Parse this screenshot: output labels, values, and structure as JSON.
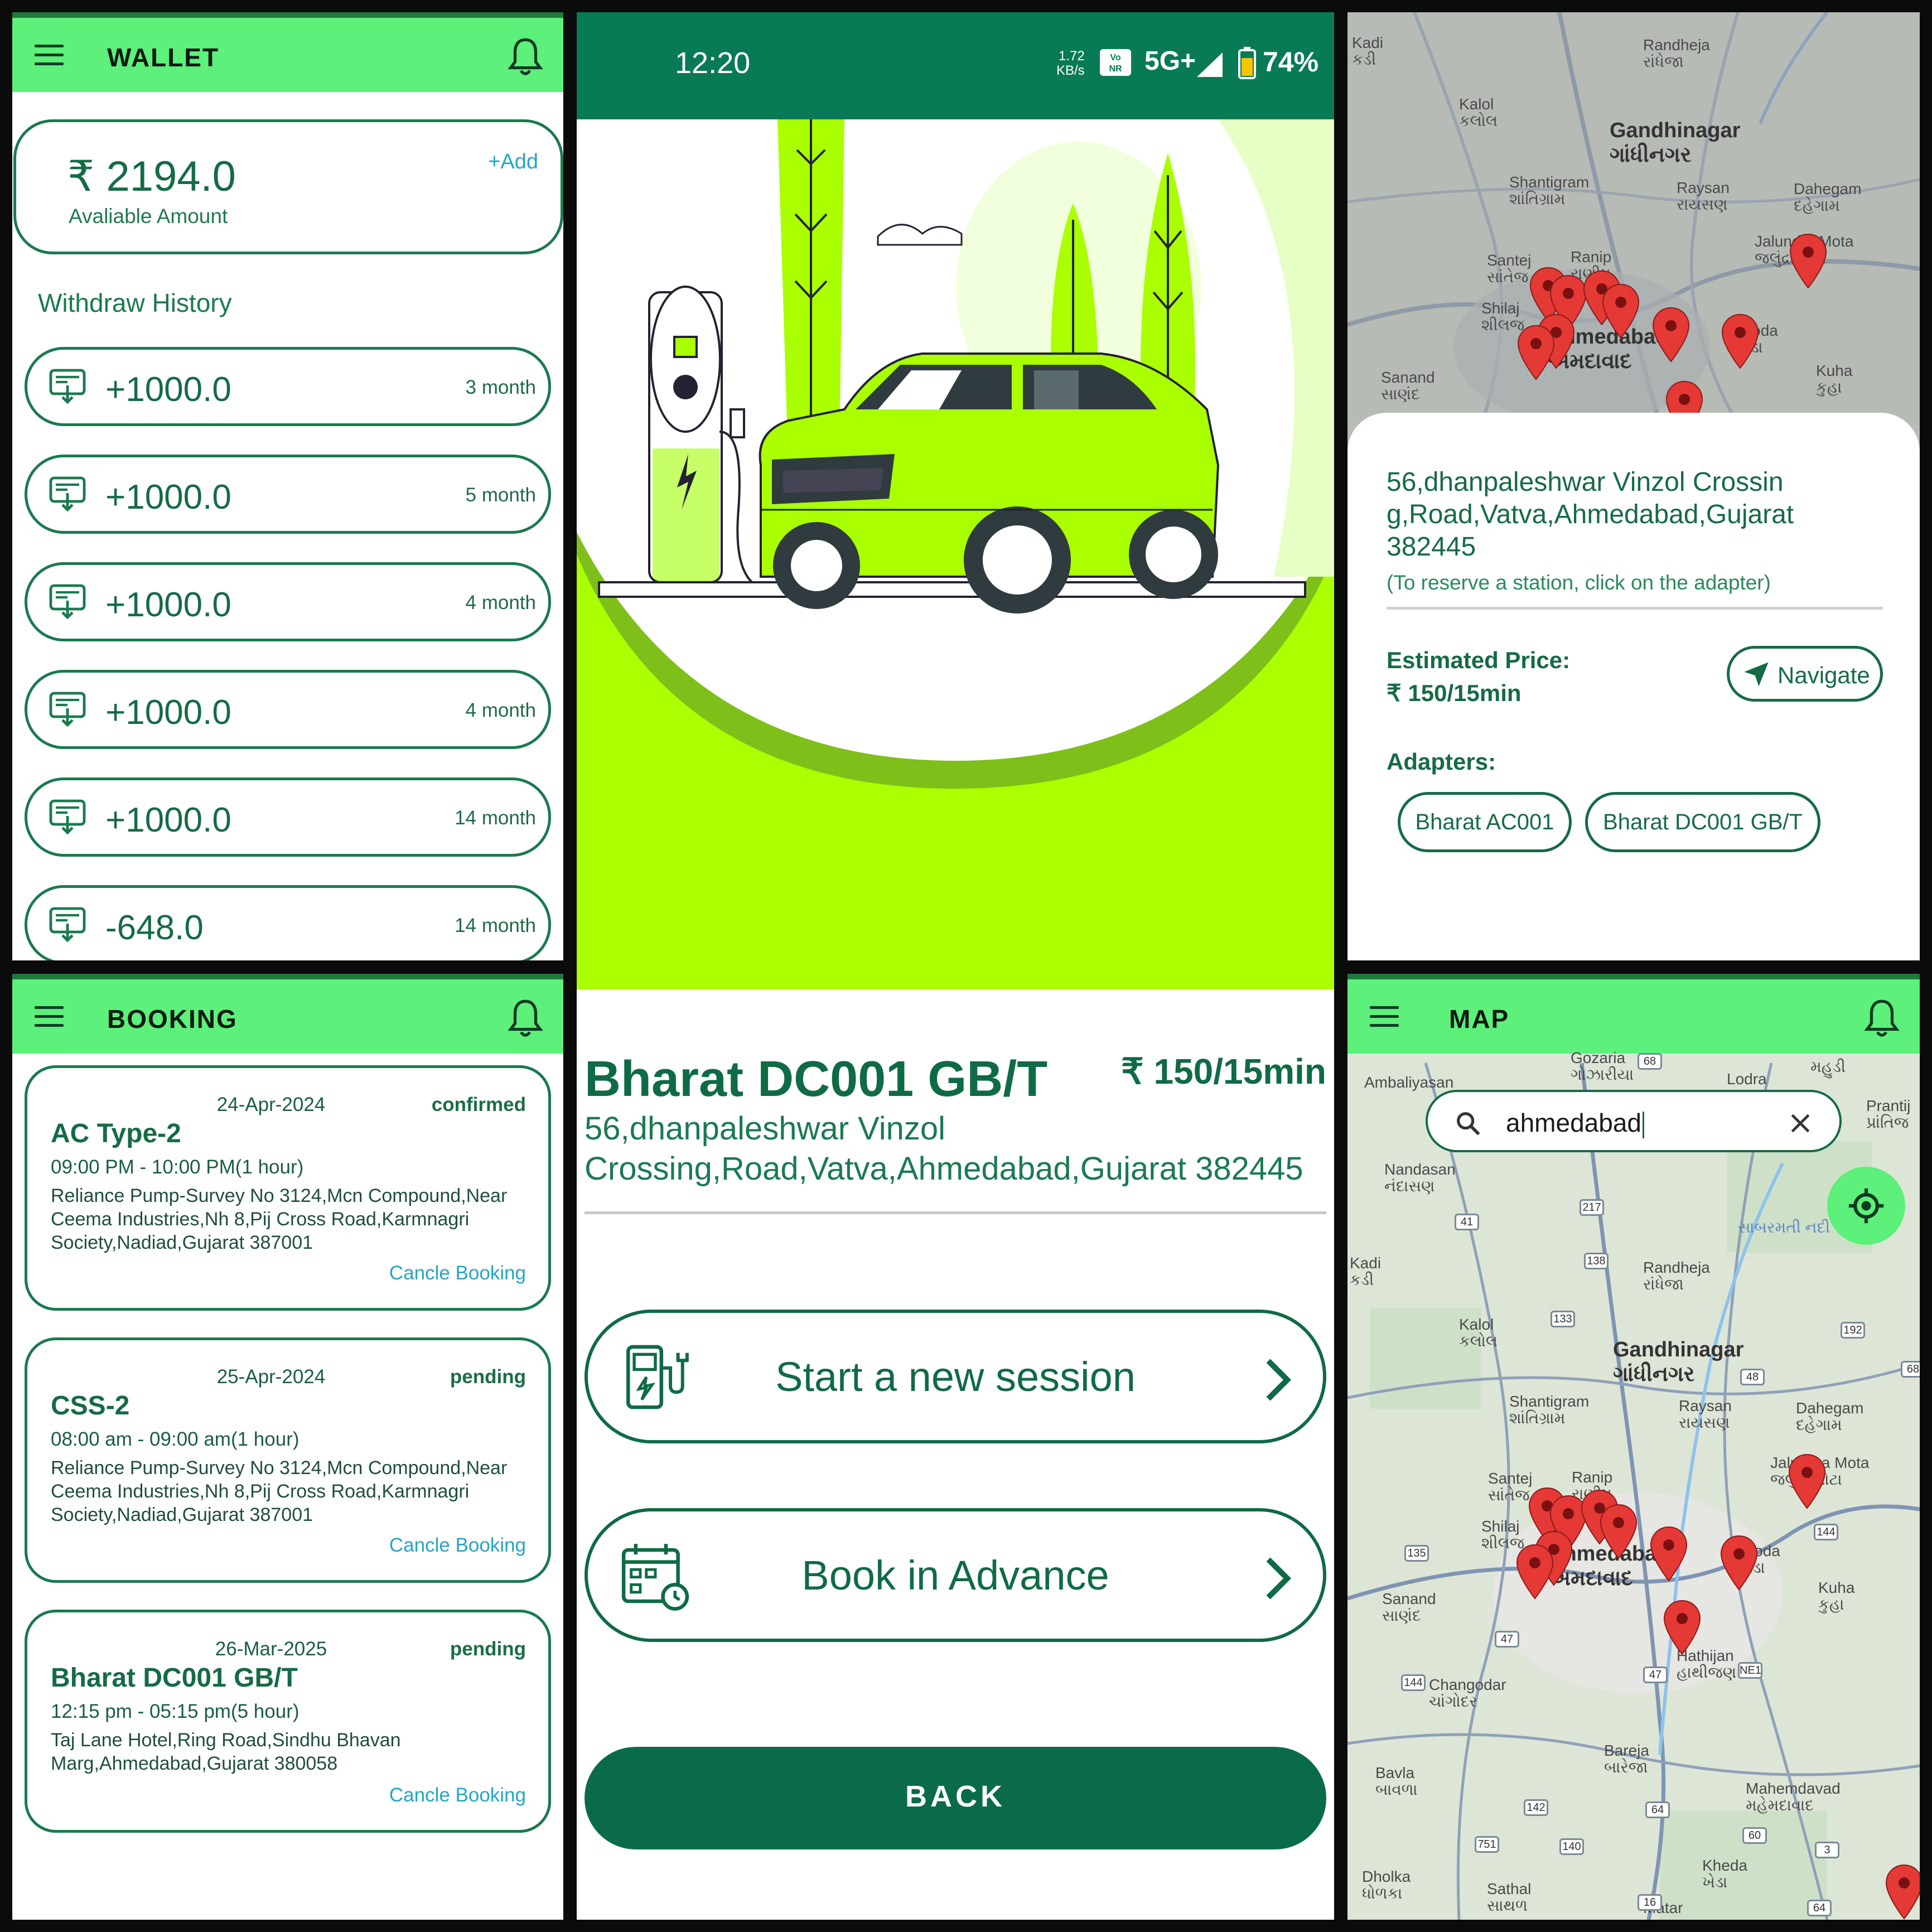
{
  "wallet": {
    "title": "WALLET",
    "amount": "₹ 2194.0",
    "amount_label": "Avaliable Amount",
    "add_label": "+Add",
    "history_title": "Withdraw History",
    "transactions": [
      {
        "amount": "+1000.0",
        "when": "3 month"
      },
      {
        "amount": "+1000.0",
        "when": "5 month"
      },
      {
        "amount": "+1000.0",
        "when": "4 month"
      },
      {
        "amount": "+1000.0",
        "when": "4 month"
      },
      {
        "amount": "+1000.0",
        "when": "14 month"
      },
      {
        "amount": "-648.0",
        "when": "14 month"
      }
    ]
  },
  "booking": {
    "title": "BOOKING",
    "cancel_label": "Cancle Booking",
    "items": [
      {
        "date": "24-Apr-2024",
        "status": "confirmed",
        "name": "AC Type-2",
        "time": "09:00 PM - 10:00 PM(1 hour)",
        "address": "Reliance Pump-Survey No 3124,Mcn Compound,Near Ceema Industries,Nh 8,Pij Cross Road,Karmnagri Society,Nadiad,Gujarat 387001"
      },
      {
        "date": "25-Apr-2024",
        "status": "pending",
        "name": "CSS-2",
        "time": "08:00 am - 09:00 am(1 hour)",
        "address": "Reliance Pump-Survey No 3124,Mcn Compound,Near Ceema Industries,Nh 8,Pij Cross Road,Karmnagri Society,Nadiad,Gujarat 387001"
      },
      {
        "date": "26-Mar-2025",
        "status": "pending",
        "name": "Bharat DC001 GB/T",
        "time": "12:15 pm - 05:15 pm(5 hour)",
        "address": "Taj Lane Hotel,Ring Road,Sindhu Bhavan Marg,Ahmedabad,Gujarat 380058"
      }
    ]
  },
  "station": {
    "status_time": "12:20",
    "status_speed": "1.72\nKB/s",
    "status_network": "5G+",
    "status_battery": "74%",
    "name": "Bharat DC001 GB/T",
    "price": "₹ 150/15min",
    "address": "56,dhanpaleshwar Vinzol Crossing,Road,Vatva,Ahmedabad,Gujarat 382445",
    "start_session_label": "Start a new session",
    "book_advance_label": "Book in Advance",
    "back_label": "BACK"
  },
  "map_detail": {
    "address": "56,dhanpaleshwar Vinzol Crossin g,Road,Vatva,Ahmedabad,Gujarat 382445",
    "hint": "(To reserve a station, click on the adapter)",
    "price_label": "Estimated Price:",
    "price_value": "₹ 150/15min",
    "navigate_label": "Navigate",
    "adapters_label": "Adapters:",
    "adapters": [
      "Bharat AC001",
      "Bharat DC001 GB/T"
    ]
  },
  "map": {
    "title": "MAP",
    "search_query": "ahmedabad",
    "places": {
      "gozaria": "Gozaria\nગોઝારીયા",
      "lodra": "Lodra",
      "mahudi": "મહુડી",
      "prantij": "Prantij\nપ્રાંતિજ",
      "ambaliyasan": "Ambaliyasan",
      "nandasan": "Nandasan\nનંદાસણ",
      "kadi": "Kadi\nકડી",
      "randheja": "Randheja\nરાંધેજા",
      "sabarmati": "સાબરમતી નદી",
      "kalol": "Kalol\nકલોલ",
      "gandhinagar": "Gandhinagar\nગાંધીનગર",
      "shantigram": "Shantigram\nશાંતિગ્રામ",
      "raysan": "Raysan\nરાયસણ",
      "dahegam": "Dahegam\nદહેગામ",
      "santej": "Santej\nસાંતેજ",
      "ranip": "Ranip\nરાણીપ",
      "jalundra": "Jalundra Mota\nજલુંદ્રા મોટા",
      "shilaj": "Shilaj\nશીલજ",
      "ahmedabad": "Ahmedabad\nઅમદાવાદ",
      "naroda": "Naroda\nનરોડા",
      "sanand": "Sanand\nસાણંદ",
      "kuha": "Kuha\nકુહા",
      "hathijan": "Hathijan\nહાથીજણ",
      "changodar": "Changodar\nચાંગોદર",
      "bareja": "Bareja\nબારેજા",
      "bavla": "Bavla\nબાવળા",
      "mahemdavad": "Mahemdavad\nમહેમદાવાદ",
      "kheda": "Kheda\nખેડા",
      "dholka": "Dholka\nધોળકા",
      "sathal": "Sathal\nસાથળ",
      "matar": "Matar"
    },
    "shields": [
      "68",
      "217",
      "41",
      "133",
      "138",
      "192",
      "48",
      "68",
      "135",
      "144",
      "47",
      "47",
      "NE1",
      "144",
      "142",
      "64",
      "751",
      "140",
      "60",
      "3",
      "16",
      "64"
    ]
  },
  "colors": {
    "brand_green": "#5df07a",
    "dark_green": "#156b45",
    "accent_lime": "#aaff00",
    "link_blue": "#25a6c4",
    "pin_red": "#e53935"
  }
}
